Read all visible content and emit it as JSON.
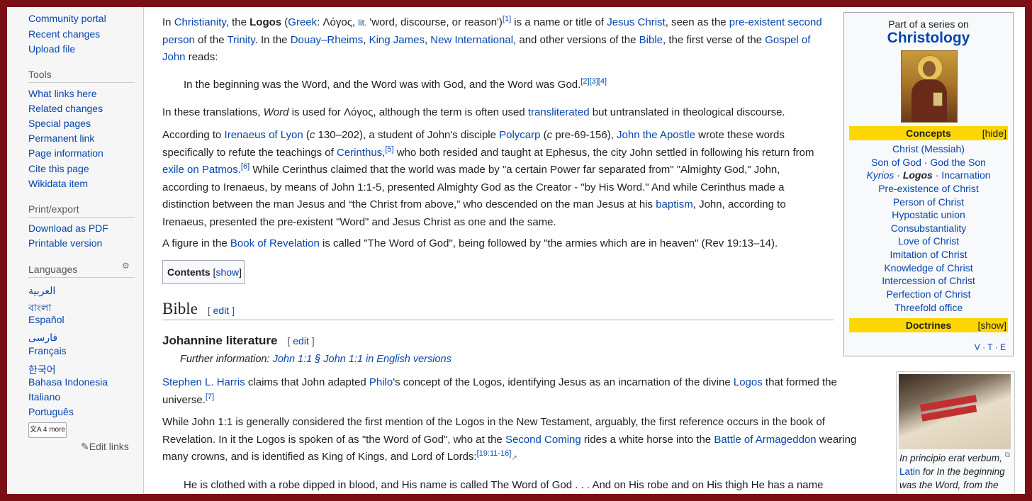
{
  "sidebar": {
    "top_links": [
      "Community portal",
      "Recent changes",
      "Upload file"
    ],
    "tools_heading": "Tools",
    "tools": [
      "What links here",
      "Related changes",
      "Special pages",
      "Permanent link",
      "Page information",
      "Cite this page",
      "Wikidata item"
    ],
    "print_heading": "Print/export",
    "print": [
      "Download as PDF",
      "Printable version"
    ],
    "languages_heading": "Languages",
    "languages": [
      "العربية",
      "বাংলা",
      "Español",
      "فارسی",
      "Français",
      "한국어",
      "Bahasa Indonesia",
      "Italiano",
      "Português"
    ],
    "more_label": "4 more",
    "edit_links": "Edit links"
  },
  "infobox": {
    "part_of": "Part of a series on",
    "title": "Christology",
    "concepts_label": "Concepts",
    "hide_label": "[hide]",
    "items": [
      "Christ (Messiah)",
      "Son of God · God the Son",
      "Kyrios · Logos · Incarnation",
      "Pre-existence of Christ",
      "Person of Christ",
      "Hypostatic union",
      "Consubstantiality",
      "Love of Christ",
      "Imitation of Christ",
      "Knowledge of Christ",
      "Intercession of Christ",
      "Perfection of Christ",
      "Threefold office"
    ],
    "doctrines_label": "Doctrines",
    "show_label": "[show]",
    "vte": "V · T · E"
  },
  "article": {
    "quote1": "In the beginning was the Word, and the Word was with God, and the Word was God.",
    "quote1_refs": "[2][3][4]",
    "toc_title": "Contents",
    "toc_toggle": "show",
    "h2": "Bible",
    "edit": "edit",
    "h3": "Johannine literature",
    "hatnote_prefix": "Further information: ",
    "hatnote_link": "John 1:1 § John 1:1 in English versions",
    "quote2": "He is clothed with a robe dipped in blood, and His name is called The Word of God . . . And on His robe and on His thigh He has a name"
  },
  "thumb": {
    "caption_pre": "In principio erat verbum, ",
    "caption_link": "Latin",
    "caption_post": " for In the beginning was the Word, from the Clementine"
  }
}
